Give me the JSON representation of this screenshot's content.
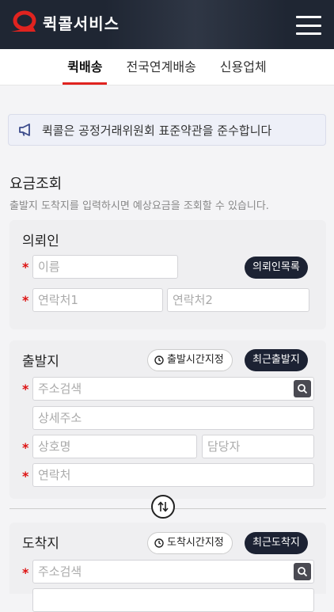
{
  "header": {
    "logo_text": "퀵콜서비스",
    "menu_icon": "hamburger-icon",
    "brand_color": "#e0231f",
    "bg_color": "#1f2633"
  },
  "tabs": [
    {
      "label": "퀵배송",
      "active": true
    },
    {
      "label": "전국연계배송",
      "active": false
    },
    {
      "label": "신용업체",
      "active": false
    }
  ],
  "notice": {
    "icon": "megaphone-icon",
    "text": "퀵콜은 공정거래위원회 표준약관을 준수합니다"
  },
  "rate": {
    "title": "요금조회",
    "subtitle": "출발지 도착지를 입력하시면 예상요금을 조회할 수 있습니다."
  },
  "requester": {
    "title": "의뢰인",
    "name_placeholder": "이름",
    "list_button": "의뢰인목록",
    "contact1_placeholder": "연락처1",
    "contact2_placeholder": "연락처2"
  },
  "departure": {
    "title": "출발지",
    "time_button": "출발시간지정",
    "recent_button": "최근출발지",
    "address_placeholder": "주소검색",
    "detail_placeholder": "상세주소",
    "company_placeholder": "상호명",
    "manager_placeholder": "담당자",
    "contact_placeholder": "연락처"
  },
  "arrival": {
    "title": "도착지",
    "time_button": "도착시간지정",
    "recent_button": "최근도착지",
    "address_placeholder": "주소검색"
  },
  "required_mark": "*"
}
